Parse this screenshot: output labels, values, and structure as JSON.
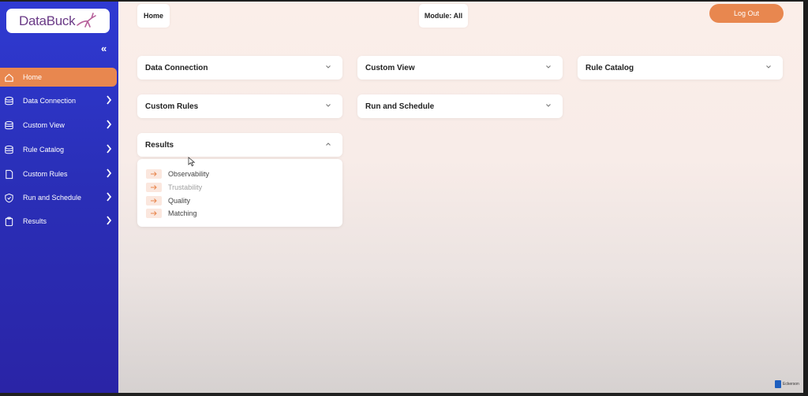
{
  "logo": {
    "text": "DataBuck"
  },
  "sidebar": {
    "collapse_icon": "double-chevron-left-icon",
    "items": [
      {
        "label": "Home",
        "icon": "home-icon",
        "active": true
      },
      {
        "label": "Data Connection",
        "icon": "database-icon"
      },
      {
        "label": "Custom View",
        "icon": "database-icon"
      },
      {
        "label": "Rule Catalog",
        "icon": "database-icon"
      },
      {
        "label": "Custom Rules",
        "icon": "file-icon"
      },
      {
        "label": "Run and Schedule",
        "icon": "shield-icon"
      },
      {
        "label": "Results",
        "icon": "clipboard-icon"
      }
    ]
  },
  "header": {
    "breadcrumb": "Home",
    "module": "Module: All",
    "logout": "Log Out"
  },
  "cards": [
    {
      "title": "Data Connection"
    },
    {
      "title": "Custom View"
    },
    {
      "title": "Rule Catalog"
    },
    {
      "title": "Custom Rules"
    },
    {
      "title": "Run and Schedule"
    },
    {
      "title": "Results",
      "expanded": true
    }
  ],
  "results_menu": [
    {
      "label": "Observability"
    },
    {
      "label": "Trustability",
      "muted": true
    },
    {
      "label": "Quality"
    },
    {
      "label": "Matching"
    }
  ],
  "watermark": {
    "text": "Eckerson"
  },
  "colors": {
    "accent": "#e8874f",
    "sidebar": "#2f3ad2",
    "background": "#fbeee9"
  }
}
